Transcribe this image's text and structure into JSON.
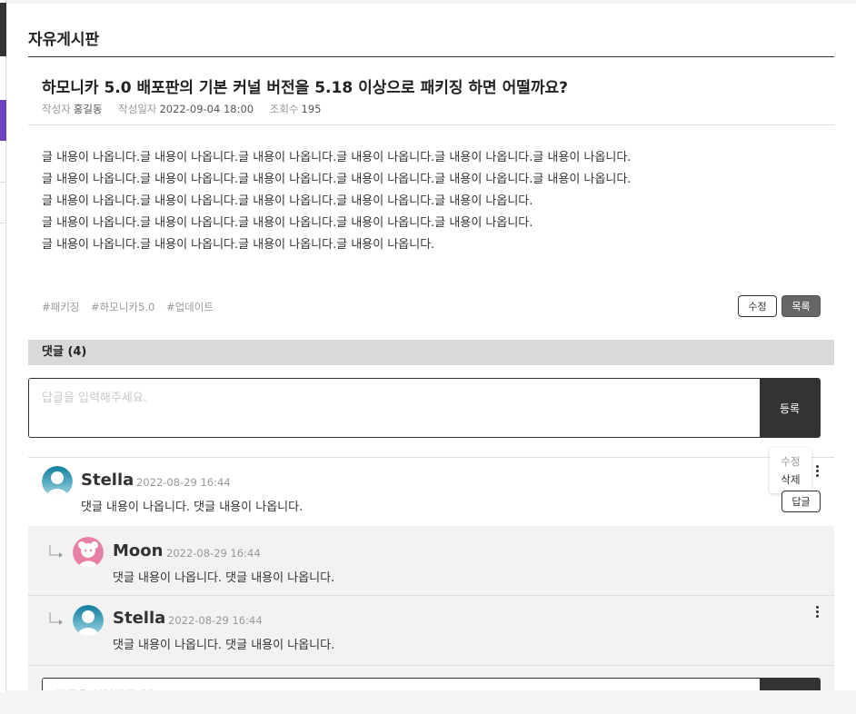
{
  "board": {
    "title": "자유게시판"
  },
  "post": {
    "title": "하모니카 5.0 배포판의 기본 커널 버전을 5.18 이상으로 패키징 하면 어떨까요?",
    "author_label": "작성자",
    "author": "홍길동",
    "date_label": "작성일자",
    "date": "2022-09-04 18:00",
    "views_label": "조회수",
    "views": "195",
    "body_lines": [
      "글 내용이 나옵니다.글 내용이 나옵니다.글 내용이 나옵니다.글 내용이 나옵니다.글 내용이 나옵니다.글 내용이 나옵니다.",
      "글 내용이 나옵니다.글 내용이 나옵니다.글 내용이 나옵니다.글 내용이 나옵니다.글 내용이 나옵니다.글 내용이 나옵니다.",
      "글 내용이 나옵니다.글 내용이 나옵니다.글 내용이 나옵니다.글 내용이 나옵니다.글 내용이 나옵니다.",
      "글 내용이 나옵니다.글 내용이 나옵니다.글 내용이 나옵니다.글 내용이 나옵니다.글 내용이 나옵니다.",
      "글 내용이 나옵니다.글 내용이 나옵니다.글 내용이 나옵니다.글 내용이 나옵니다."
    ],
    "tags": [
      "#패키징",
      "#하모니카5.0",
      "#업데이트"
    ],
    "edit_label": "수정",
    "list_label": "목록"
  },
  "comments": {
    "header": "댓글 (4)",
    "input_placeholder": "답글을 입력해주세요.",
    "register_label": "등록",
    "popup": {
      "edit": "수정",
      "delete": "삭제"
    },
    "reply_label": "답글",
    "items": [
      {
        "name": "Stella",
        "date": "2022-08-29 16:44",
        "text": "댓글 내용이 나옵니다. 댓글 내용이 나옵니다."
      }
    ],
    "replies": [
      {
        "name": "Moon",
        "date": "2022-08-29 16:44",
        "text": "댓글 내용이 나옵니다. 댓글 내용이 나옵니다."
      },
      {
        "name": "Stella",
        "date": "2022-08-29 16:44",
        "text": "댓글 내용이 나옵니다. 댓글 내용이 나옵니다."
      }
    ],
    "reply_input_placeholder": "답글을 입력해주세요."
  },
  "colors": {
    "accent": "#6f42c1",
    "dark": "#333333",
    "avatar_blue": "#1a8fb0",
    "avatar_pink": "#e87fa6"
  }
}
